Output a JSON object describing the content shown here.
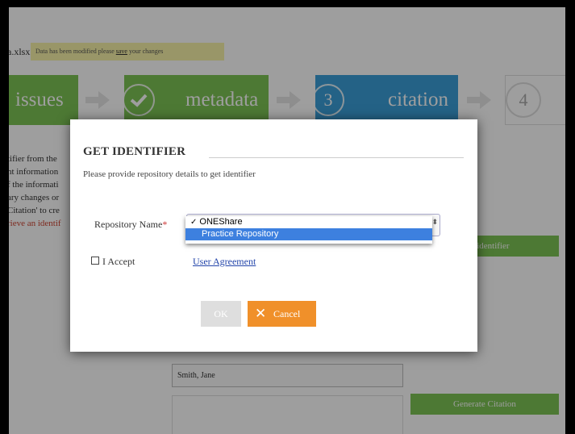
{
  "file": {
    "name": "a.xlsx"
  },
  "notice": {
    "text": "Data has been modified please",
    "link": "save",
    "suffix": "your changes"
  },
  "steps": [
    {
      "label": "issues"
    },
    {
      "label": "metadata"
    },
    {
      "number": "3",
      "label": "citation"
    },
    {
      "number": "4"
    }
  ],
  "left_text": {
    "lines": [
      "tifier from the",
      "nt information",
      "f the informati",
      "ary changes or",
      "Citation' to cre"
    ],
    "link": "rieve an identif"
  },
  "background": {
    "identifier_button": "e an identifier",
    "author_value": "Smith, Jane",
    "generate_button": "Generate Citation"
  },
  "modal": {
    "title": "GET IDENTIFIER",
    "description": "Please provide repository details to get identifier",
    "repo_label": "Repository Name",
    "required_mark": "*",
    "options": [
      "ONEShare",
      "Practice Repository"
    ],
    "selected": "ONEShare",
    "check_mark": "✓",
    "accept_label": "I Accept",
    "agreement_link": "User Agreement",
    "ok_label": "OK",
    "cancel_label": "Cancel"
  },
  "colors": {
    "step_done": "#7cc355",
    "step_active": "#3a9fd8",
    "cancel": "#f0902a",
    "highlight": "#3d80df"
  }
}
